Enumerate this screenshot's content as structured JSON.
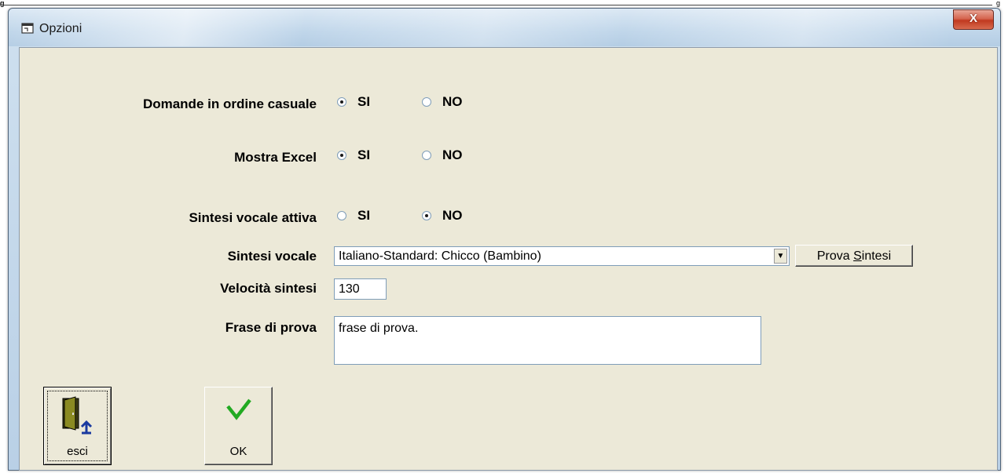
{
  "window": {
    "title": "Opzioni",
    "close_label": "X",
    "app_icon": "window-icon"
  },
  "page_strip": {
    "left_mark": "g",
    "right_mark": "g"
  },
  "options": {
    "random_order": {
      "label": "Domande in ordine casuale",
      "yes": "SI",
      "no": "NO",
      "selected": "SI"
    },
    "show_excel": {
      "label": "Mostra Excel",
      "yes": "SI",
      "no": "NO",
      "selected": "SI"
    },
    "voice_active": {
      "label": "Sintesi vocale attiva",
      "yes": "SI",
      "no": "NO",
      "selected": "NO"
    },
    "voice": {
      "label": "Sintesi vocale",
      "value": "Italiano-Standard: Chicco (Bambino)"
    },
    "test_button": {
      "label_before": "Prova ",
      "label_accel": "S",
      "label_after": "intesi"
    },
    "speed": {
      "label": "Velocità sintesi",
      "value": "130"
    },
    "test_phrase": {
      "label": "Frase di prova",
      "value": "frase di prova."
    }
  },
  "buttons": {
    "exit": {
      "label": "esci",
      "icon": "exit-door-icon"
    },
    "ok": {
      "label": "OK",
      "icon": "checkmark-icon"
    }
  },
  "colors": {
    "checkmark": "#22aa22",
    "door": "#6b6b1e",
    "arrow": "#1a3aa0"
  }
}
